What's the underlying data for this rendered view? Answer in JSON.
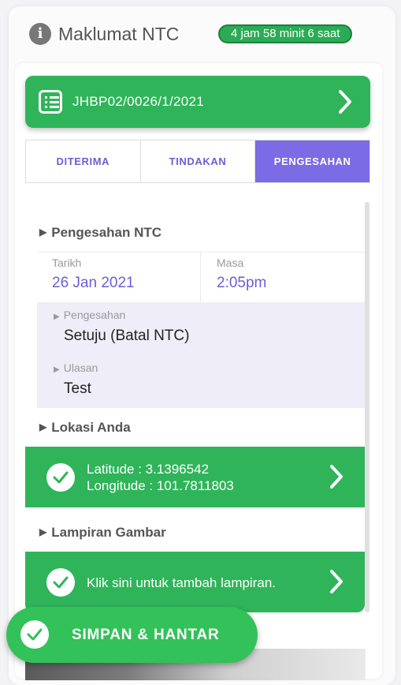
{
  "header": {
    "title": "Maklumat NTC",
    "timer": "4 jam 58 minit 6 saat"
  },
  "reference": {
    "number": "JHBP02/0026/1/2021"
  },
  "tabs": [
    {
      "label": "DITERIMA",
      "active": false
    },
    {
      "label": "TINDAKAN",
      "active": false
    },
    {
      "label": "PENGESAHAN",
      "active": true
    }
  ],
  "pengesahan": {
    "section_title": "Pengesahan NTC",
    "date_label": "Tarikh",
    "date_value": "26 Jan 2021",
    "time_label": "Masa",
    "time_value": "2:05pm",
    "confirmation_label": "Pengesahan",
    "confirmation_value": "Setuju (Batal NTC)",
    "remarks_label": "Ulasan",
    "remarks_value": "Test"
  },
  "location": {
    "section_title": "Lokasi Anda",
    "latitude_text": "Latitude : 3.1396542",
    "longitude_text": "Longitude : 101.7811803"
  },
  "attachments": {
    "section_title": "Lampiran Gambar",
    "action_text": "Klik sini untuk tambah lampiran."
  },
  "actions": {
    "save_label": "SIMPAN & HANTAR"
  },
  "colors": {
    "primary_green": "#2fb45a",
    "accent_purple": "#7b6be4",
    "tab_text": "#6a5fd6"
  }
}
